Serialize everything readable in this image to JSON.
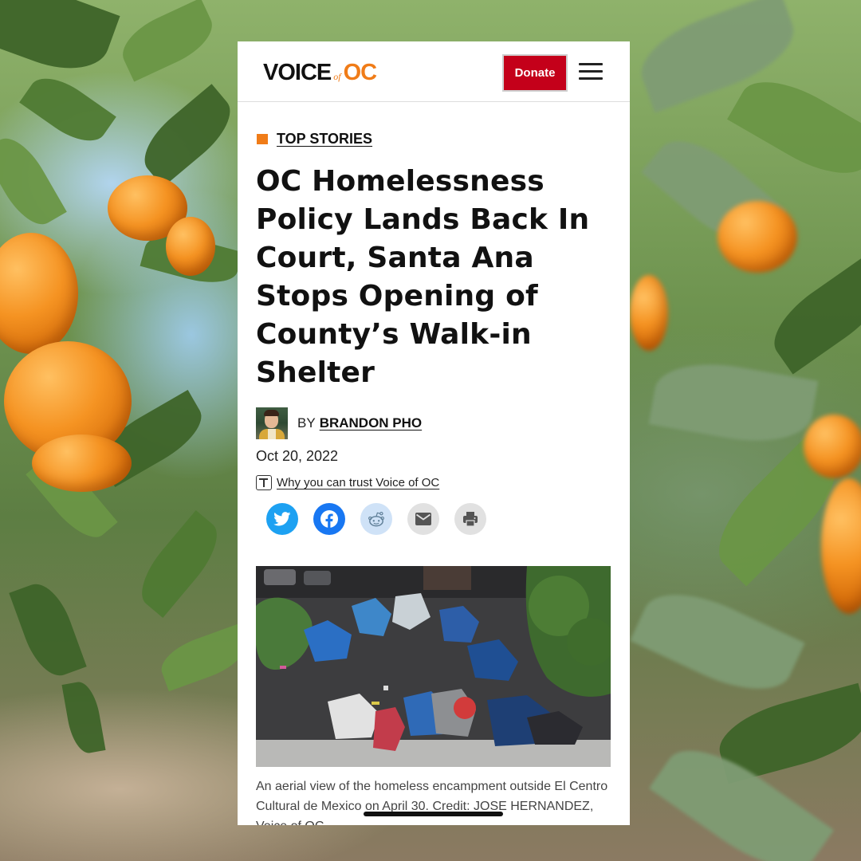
{
  "header": {
    "logo": {
      "voice": "VOICE",
      "of": "of",
      "oc": "OC"
    },
    "donate_label": "Donate",
    "menu_icon": "hamburger-menu-icon"
  },
  "article": {
    "category": "TOP STORIES",
    "headline": "OC Homelessness Policy Lands Back In Court, Santa Ana Stops Opening of County’s Walk-in Shelter",
    "by_prefix": "BY",
    "author": "BRANDON PHO",
    "date": "Oct 20, 2022",
    "trust_link": "Why you can trust Voice of OC",
    "share_buttons": [
      {
        "icon": "twitter-icon",
        "color": "#1da1f2"
      },
      {
        "icon": "facebook-icon",
        "color": "#1877f2"
      },
      {
        "icon": "reddit-icon",
        "color": "#cfe2f7"
      },
      {
        "icon": "email-icon",
        "color": "#e1e1e1"
      },
      {
        "icon": "print-icon",
        "color": "#e1e1e1"
      }
    ],
    "caption": "An aerial view of the homeless encampment outside El Centro Cultural de Mexico on April 30. Credit: JOSE HERNANDEZ, Voice of OC"
  },
  "colors": {
    "accent_orange": "#f07c18",
    "donate_red": "#c4001a"
  }
}
